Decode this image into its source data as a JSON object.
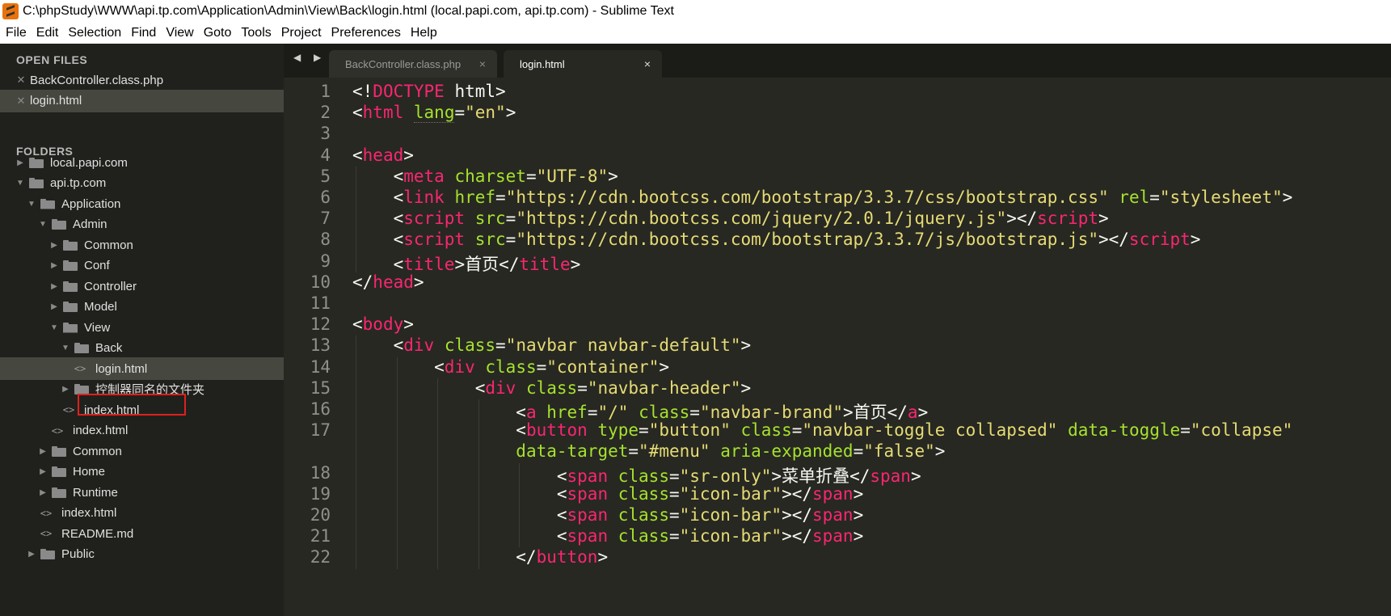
{
  "window": {
    "title": "C:\\phpStudy\\WWW\\api.tp.com\\Application\\Admin\\View\\Back\\login.html (local.papi.com, api.tp.com) - Sublime Text"
  },
  "menu": [
    "File",
    "Edit",
    "Selection",
    "Find",
    "View",
    "Goto",
    "Tools",
    "Project",
    "Preferences",
    "Help"
  ],
  "sidebar": {
    "open_files_header": "OPEN FILES",
    "open_files": [
      "BackController.class.php",
      "login.html"
    ],
    "folders_header": "FOLDERS",
    "tree": [
      {
        "label": "local.papi.com",
        "type": "folder",
        "state": "collapsed"
      },
      {
        "label": "api.tp.com",
        "type": "folder",
        "state": "expanded"
      },
      {
        "label": "Application",
        "type": "folder",
        "state": "expanded"
      },
      {
        "label": "Admin",
        "type": "folder",
        "state": "expanded"
      },
      {
        "label": "Common",
        "type": "folder",
        "state": "collapsed"
      },
      {
        "label": "Conf",
        "type": "folder",
        "state": "collapsed"
      },
      {
        "label": "Controller",
        "type": "folder",
        "state": "collapsed"
      },
      {
        "label": "Model",
        "type": "folder",
        "state": "collapsed"
      },
      {
        "label": "View",
        "type": "folder",
        "state": "expanded"
      },
      {
        "label": "Back",
        "type": "folder",
        "state": "expanded"
      },
      {
        "label": "login.html",
        "type": "file"
      },
      {
        "label": "控制器同名的文件夹",
        "type": "folder",
        "state": "collapsed"
      },
      {
        "label": "index.html",
        "type": "file"
      },
      {
        "label": "index.html",
        "type": "file"
      },
      {
        "label": "Common",
        "type": "folder",
        "state": "collapsed"
      },
      {
        "label": "Home",
        "type": "folder",
        "state": "collapsed"
      },
      {
        "label": "Runtime",
        "type": "folder",
        "state": "collapsed"
      },
      {
        "label": "index.html",
        "type": "file"
      },
      {
        "label": "README.md",
        "type": "file"
      },
      {
        "label": "Public",
        "type": "folder",
        "state": "collapsed"
      }
    ]
  },
  "tabs": [
    {
      "label": "BackController.class.php",
      "close": "×"
    },
    {
      "label": "login.html",
      "close": "×"
    }
  ],
  "nav_arrows": "◀ ▶",
  "editor": {
    "line_numbers": [
      "1",
      "2",
      "3",
      "4",
      "5",
      "6",
      "7",
      "8",
      "9",
      "10",
      "11",
      "12",
      "13",
      "14",
      "15",
      "16",
      "17",
      "",
      "18",
      "19",
      "20",
      "21",
      "22"
    ],
    "lines": [
      [
        [
          "p",
          "<!"
        ],
        [
          "t",
          "DOCTYPE"
        ],
        [
          "p",
          " html>"
        ]
      ],
      [
        [
          "p",
          "<"
        ],
        [
          "t",
          "html"
        ],
        [
          "p",
          " "
        ],
        [
          "a",
          "lang"
        ],
        [
          "p",
          "="
        ],
        [
          "s",
          "\"en\""
        ],
        [
          "p",
          ">"
        ]
      ],
      [],
      [
        [
          "p",
          "<"
        ],
        [
          "t",
          "head"
        ],
        [
          "p",
          ">"
        ]
      ],
      [
        [
          "p",
          "    <"
        ],
        [
          "t",
          "meta"
        ],
        [
          "p",
          " "
        ],
        [
          "a",
          "charset"
        ],
        [
          "p",
          "="
        ],
        [
          "s",
          "\"UTF-8\""
        ],
        [
          "p",
          ">"
        ]
      ],
      [
        [
          "p",
          "    <"
        ],
        [
          "t",
          "link"
        ],
        [
          "p",
          " "
        ],
        [
          "a",
          "href"
        ],
        [
          "p",
          "="
        ],
        [
          "s",
          "\"https://cdn.bootcss.com/bootstrap/3.3.7/css/bootstrap.css\""
        ],
        [
          "p",
          " "
        ],
        [
          "a",
          "rel"
        ],
        [
          "p",
          "="
        ],
        [
          "s",
          "\"stylesheet\""
        ],
        [
          "p",
          ">"
        ]
      ],
      [
        [
          "p",
          "    <"
        ],
        [
          "t",
          "script"
        ],
        [
          "p",
          " "
        ],
        [
          "a",
          "src"
        ],
        [
          "p",
          "="
        ],
        [
          "s",
          "\"https://cdn.bootcss.com/jquery/2.0.1/jquery.js\""
        ],
        [
          "p",
          "></"
        ],
        [
          "t",
          "script"
        ],
        [
          "p",
          ">"
        ]
      ],
      [
        [
          "p",
          "    <"
        ],
        [
          "t",
          "script"
        ],
        [
          "p",
          " "
        ],
        [
          "a",
          "src"
        ],
        [
          "p",
          "="
        ],
        [
          "s",
          "\"https://cdn.bootcss.com/bootstrap/3.3.7/js/bootstrap.js\""
        ],
        [
          "p",
          "></"
        ],
        [
          "t",
          "script"
        ],
        [
          "p",
          ">"
        ]
      ],
      [
        [
          "p",
          "    <"
        ],
        [
          "t",
          "title"
        ],
        [
          "p",
          ">首页</"
        ],
        [
          "t",
          "title"
        ],
        [
          "p",
          ">"
        ]
      ],
      [
        [
          "p",
          "</"
        ],
        [
          "t",
          "head"
        ],
        [
          "p",
          ">"
        ]
      ],
      [],
      [
        [
          "p",
          "<"
        ],
        [
          "t",
          "body"
        ],
        [
          "p",
          ">"
        ]
      ],
      [
        [
          "p",
          "    <"
        ],
        [
          "t",
          "div"
        ],
        [
          "p",
          " "
        ],
        [
          "a",
          "class"
        ],
        [
          "p",
          "="
        ],
        [
          "s",
          "\"navbar navbar-default\""
        ],
        [
          "p",
          ">"
        ]
      ],
      [
        [
          "p",
          "        <"
        ],
        [
          "t",
          "div"
        ],
        [
          "p",
          " "
        ],
        [
          "a",
          "class"
        ],
        [
          "p",
          "="
        ],
        [
          "s",
          "\"container\""
        ],
        [
          "p",
          ">"
        ]
      ],
      [
        [
          "p",
          "            <"
        ],
        [
          "t",
          "div"
        ],
        [
          "p",
          " "
        ],
        [
          "a",
          "class"
        ],
        [
          "p",
          "="
        ],
        [
          "s",
          "\"navbar-header\""
        ],
        [
          "p",
          ">"
        ]
      ],
      [
        [
          "p",
          "                <"
        ],
        [
          "t",
          "a"
        ],
        [
          "p",
          " "
        ],
        [
          "a",
          "href"
        ],
        [
          "p",
          "="
        ],
        [
          "s",
          "\"/\""
        ],
        [
          "p",
          " "
        ],
        [
          "a",
          "class"
        ],
        [
          "p",
          "="
        ],
        [
          "s",
          "\"navbar-brand\""
        ],
        [
          "p",
          ">首页</"
        ],
        [
          "t",
          "a"
        ],
        [
          "p",
          ">"
        ]
      ],
      [
        [
          "p",
          "                <"
        ],
        [
          "t",
          "button"
        ],
        [
          "p",
          " "
        ],
        [
          "a",
          "type"
        ],
        [
          "p",
          "="
        ],
        [
          "s",
          "\"button\""
        ],
        [
          "p",
          " "
        ],
        [
          "a",
          "class"
        ],
        [
          "p",
          "="
        ],
        [
          "s",
          "\"navbar-toggle collapsed\""
        ],
        [
          "p",
          " "
        ],
        [
          "a",
          "data-toggle"
        ],
        [
          "p",
          "="
        ],
        [
          "s",
          "\"collapse\""
        ]
      ],
      [
        [
          "p",
          "                "
        ],
        [
          "a",
          "data-target"
        ],
        [
          "p",
          "="
        ],
        [
          "s",
          "\"#menu\""
        ],
        [
          "p",
          " "
        ],
        [
          "a",
          "aria-expanded"
        ],
        [
          "p",
          "="
        ],
        [
          "s",
          "\"false\""
        ],
        [
          "p",
          ">"
        ]
      ],
      [
        [
          "p",
          "                    <"
        ],
        [
          "t",
          "span"
        ],
        [
          "p",
          " "
        ],
        [
          "a",
          "class"
        ],
        [
          "p",
          "="
        ],
        [
          "s",
          "\"sr-only\""
        ],
        [
          "p",
          ">菜单折叠</"
        ],
        [
          "t",
          "span"
        ],
        [
          "p",
          ">"
        ]
      ],
      [
        [
          "p",
          "                    <"
        ],
        [
          "t",
          "span"
        ],
        [
          "p",
          " "
        ],
        [
          "a",
          "class"
        ],
        [
          "p",
          "="
        ],
        [
          "s",
          "\"icon-bar\""
        ],
        [
          "p",
          "></"
        ],
        [
          "t",
          "span"
        ],
        [
          "p",
          ">"
        ]
      ],
      [
        [
          "p",
          "                    <"
        ],
        [
          "t",
          "span"
        ],
        [
          "p",
          " "
        ],
        [
          "a",
          "class"
        ],
        [
          "p",
          "="
        ],
        [
          "s",
          "\"icon-bar\""
        ],
        [
          "p",
          "></"
        ],
        [
          "t",
          "span"
        ],
        [
          "p",
          ">"
        ]
      ],
      [
        [
          "p",
          "                    <"
        ],
        [
          "t",
          "span"
        ],
        [
          "p",
          " "
        ],
        [
          "a",
          "class"
        ],
        [
          "p",
          "="
        ],
        [
          "s",
          "\"icon-bar\""
        ],
        [
          "p",
          "></"
        ],
        [
          "t",
          "span"
        ],
        [
          "p",
          ">"
        ]
      ],
      [
        [
          "p",
          "                </"
        ],
        [
          "t",
          "button"
        ],
        [
          "p",
          ">"
        ]
      ]
    ]
  },
  "colors": {
    "tag": "#f92672",
    "attr": "#a6e22e",
    "string": "#e6db74",
    "text": "#f8f8f2",
    "editor_bg": "#272822",
    "sidebar_bg": "#20211c",
    "highlight_box": "#e02020"
  }
}
